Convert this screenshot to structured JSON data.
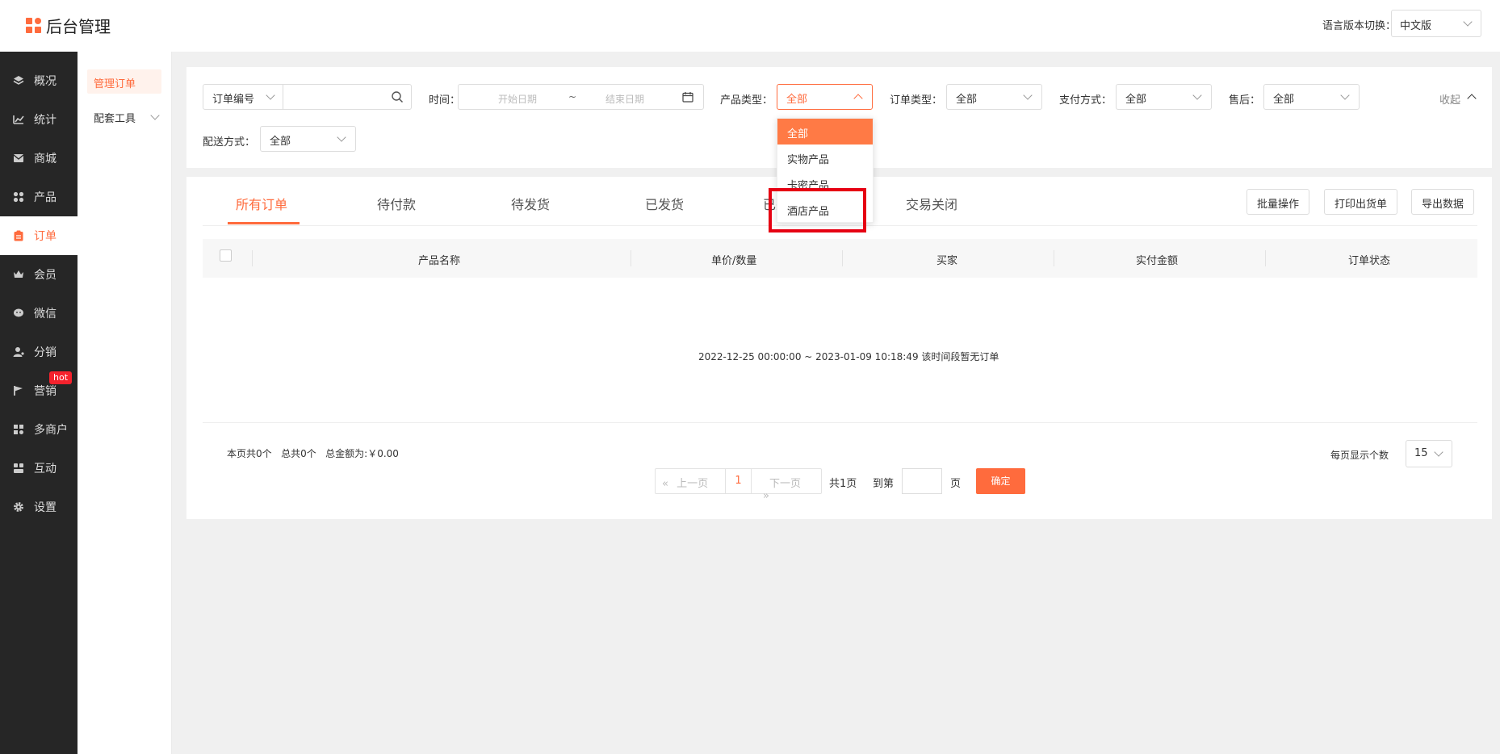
{
  "header": {
    "logo_text": "后台管理",
    "lang_label": "语言版本切换：",
    "lang_value": "中文版"
  },
  "sidebar": {
    "items": [
      {
        "label": "概况",
        "icon": "layers-icon"
      },
      {
        "label": "统计",
        "icon": "chart-icon"
      },
      {
        "label": "商城",
        "icon": "mail-icon"
      },
      {
        "label": "产品",
        "icon": "grid-icon"
      },
      {
        "label": "订单",
        "icon": "clipboard-icon"
      },
      {
        "label": "会员",
        "icon": "crown-icon"
      },
      {
        "label": "微信",
        "icon": "wechat-icon"
      },
      {
        "label": "分销",
        "icon": "user-share-icon"
      },
      {
        "label": "营销",
        "icon": "flag-icon"
      },
      {
        "label": "多商户",
        "icon": "shop-icon"
      },
      {
        "label": "互动",
        "icon": "people-icon"
      },
      {
        "label": "设置",
        "icon": "gear-icon"
      }
    ],
    "hot_badge": "hot",
    "active": "订单"
  },
  "subnav": {
    "active": "管理订单",
    "tools": "配套工具"
  },
  "filters": {
    "order_no_select": "订单编号",
    "time_label": "时间：",
    "start_date_placeholder": "开始日期",
    "date_separator": "~",
    "end_date_placeholder": "结束日期",
    "product_type_label": "产品类型：",
    "product_type_value": "全部",
    "order_type_label": "订单类型：",
    "order_type_value": "全部",
    "payment_label": "支付方式：",
    "payment_value": "全部",
    "aftersale_label": "售后：",
    "aftersale_value": "全部",
    "collapse": "收起",
    "delivery_label": "配送方式：",
    "delivery_value": "全部"
  },
  "dropdown": {
    "options": [
      "全部",
      "实物产品",
      "卡密产品",
      "酒店产品"
    ],
    "selected": "全部",
    "highlight_color": "#e60012"
  },
  "tabs": [
    "所有订单",
    "待付款",
    "待发货",
    "已发货",
    "已完成",
    "交易关闭"
  ],
  "actions": {
    "batch": "批量操作",
    "print": "打印出货单",
    "export": "导出数据"
  },
  "table": {
    "columns": [
      "产品名称",
      "单价/数量",
      "买家",
      "实付金额",
      "订单状态"
    ],
    "empty_message": "2022-12-25 00:00:00 ~ 2023-01-09 10:18:49 该时间段暂无订单"
  },
  "summary": "本页共0个   总共0个   总金额为:￥0.00",
  "pagination": {
    "prev": "上一页",
    "current_page": "1",
    "next": "下一页",
    "total_pages": "共1页",
    "goto": "到第",
    "page_unit": "页",
    "confirm": "确定",
    "per_page_label": "每页显示个数",
    "per_page_value": "15"
  },
  "colors": {
    "accent": "#ff6b3d",
    "sidebar_bg": "#262626"
  }
}
